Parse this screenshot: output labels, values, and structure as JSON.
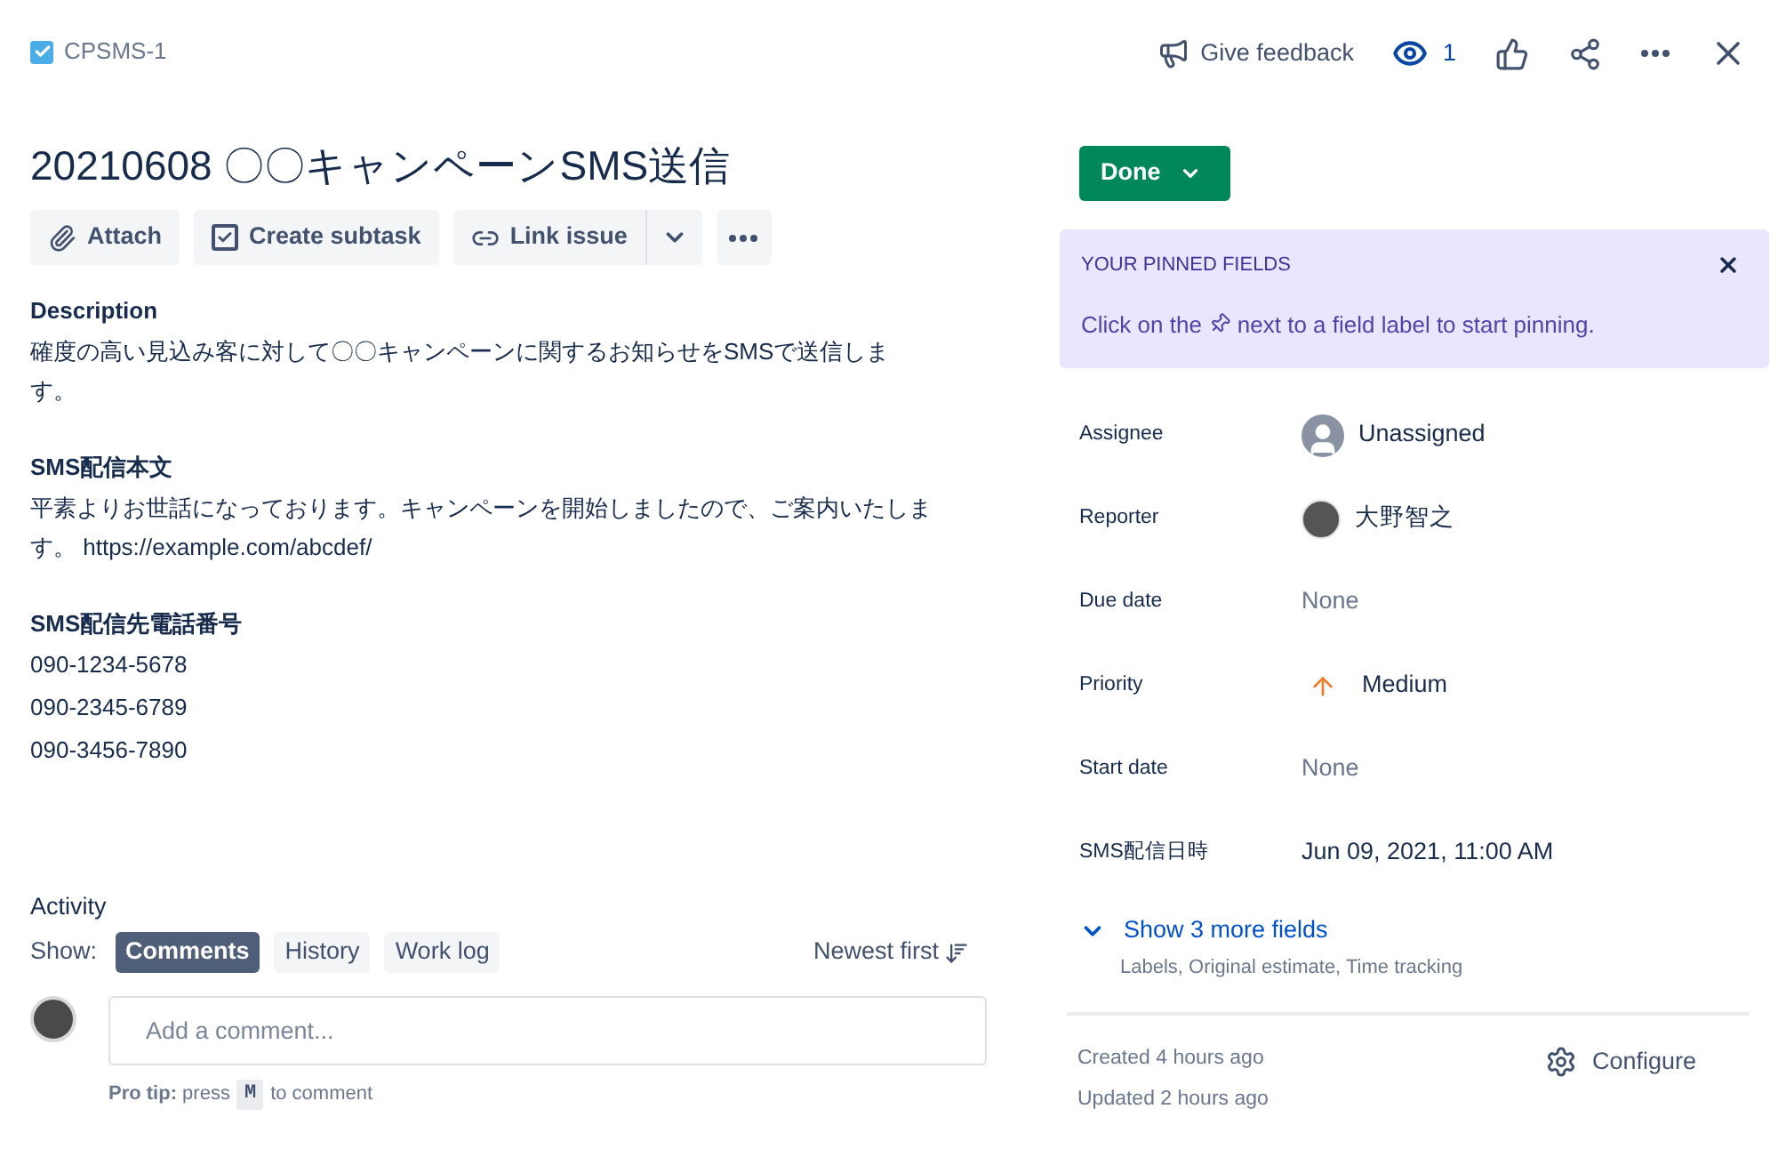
{
  "issue_key": "CPSMS-1",
  "header_actions": {
    "feedback": "Give feedback",
    "watchers": "1"
  },
  "title": "20210608 〇〇キャンペーンSMS送信",
  "toolbar": [
    "Attach",
    "Create subtask",
    "Link issue"
  ],
  "sections": [
    {
      "heading": "Description",
      "lines": [
        "確度の高い見込み客に対して〇〇キャンペーンに関するお知らせをSMSで送信します。"
      ]
    },
    {
      "heading": "SMS配信本文",
      "lines": [
        "平素よりお世話になっております。キャンペーンを開始しましたので、ご案内いたします。 https://example.com/abcdef/"
      ]
    },
    {
      "heading": "SMS配信先電話番号",
      "lines": [
        "090-1234-5678",
        "090-2345-6789",
        "090-3456-7890"
      ]
    }
  ],
  "activity": {
    "title": "Activity",
    "show_label": "Show:",
    "filters": [
      {
        "label": "Comments",
        "selected": true
      },
      {
        "label": "History",
        "selected": false
      },
      {
        "label": "Work log",
        "selected": false
      }
    ],
    "sort": "Newest first",
    "comment_placeholder": "Add a comment...",
    "pro_tip_before": "**Pro tip:** press",
    "pro_tip_key": "M",
    "pro_tip_after": "to comment"
  },
  "status": "Done",
  "pinned": {
    "title": "YOUR PINNED FIELDS",
    "text_before": "Click on the",
    "text_after": "next to a field label to start pinning."
  },
  "fields": [
    {
      "label": "Assignee",
      "kind": "unassigned",
      "value": "Unassigned"
    },
    {
      "label": "Reporter",
      "kind": "user",
      "value": "大野智之"
    },
    {
      "label": "Due date",
      "kind": "empty",
      "value": "None"
    },
    {
      "label": "Priority",
      "kind": "priority",
      "value": "Medium"
    },
    {
      "label": "Start date",
      "kind": "empty",
      "value": "None"
    },
    {
      "label": "SMS配信日時",
      "kind": "text",
      "value": "Jun 09, 2021, 11:00 AM"
    }
  ],
  "more_fields": {
    "label": "Show 3 more fields",
    "hint": "Labels, Original estimate, Time tracking"
  },
  "footer": {
    "created": "Created 4 hours ago",
    "updated": "Updated 2 hours ago",
    "configure": "Configure"
  }
}
